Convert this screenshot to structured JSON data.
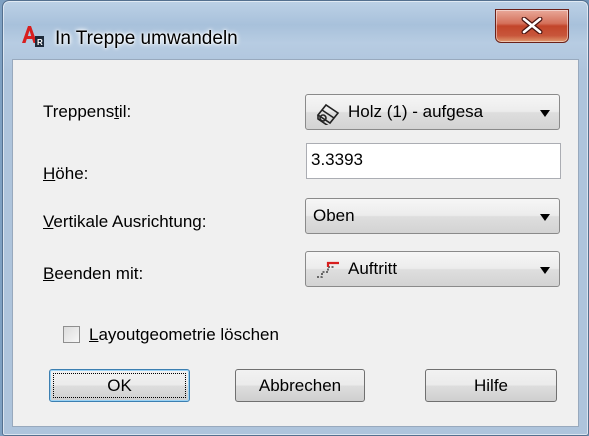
{
  "window": {
    "title": "In Treppe umwandeln",
    "close_label": "X"
  },
  "form": {
    "style_label": "Treppenstil:",
    "style_value": "Holz (1) - aufgesa",
    "height_label": "Höhe:",
    "height_value": "3.3393",
    "vertical_label": "Vertikale Ausrichtung:",
    "vertical_value": "Oben",
    "end_label": "Beenden mit:",
    "end_value": "Auftritt",
    "checkbox_label": "Layoutgeometrie löschen",
    "checkbox_checked": false
  },
  "buttons": {
    "ok": "OK",
    "cancel": "Abbrechen",
    "help": "Hilfe"
  },
  "icons": {
    "title_icon": "autocad-architecture-icon",
    "style_icon": "stair-style-icon",
    "end_icon": "riser-tread-icon"
  },
  "colors": {
    "title_bar": "#a8c1db",
    "close_button": "#c8563b",
    "client_background": "#f0f0f0",
    "icon_red": "#d81f1f"
  }
}
